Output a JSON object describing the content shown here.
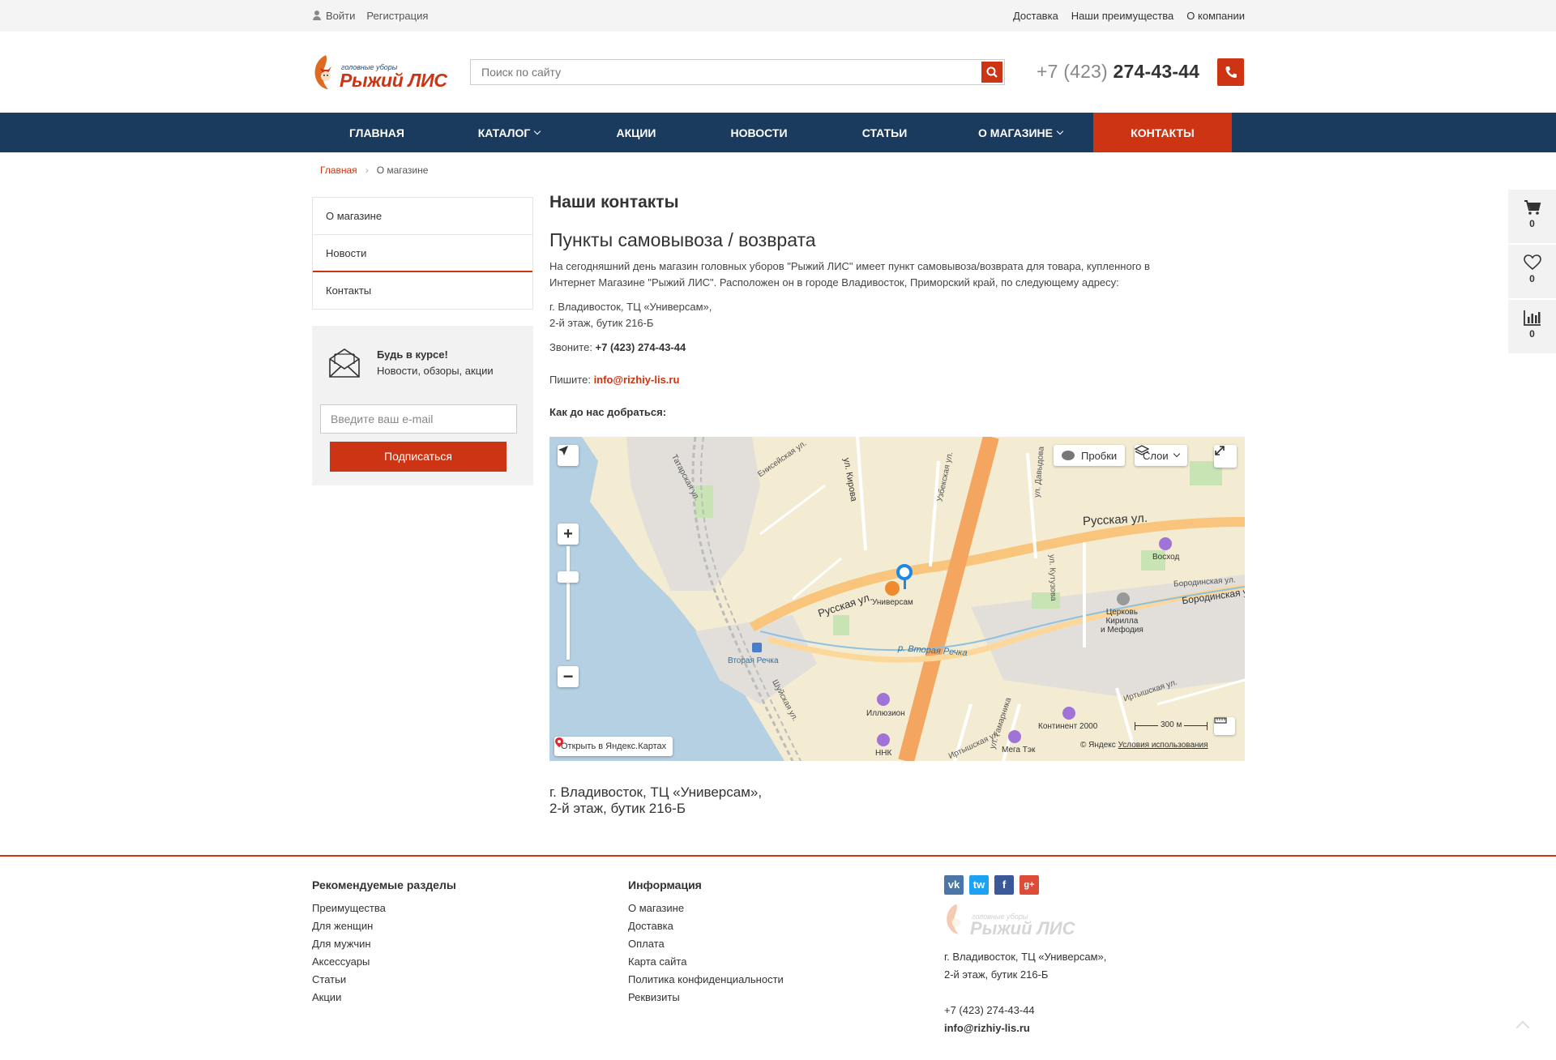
{
  "topbar": {
    "login": "Войти",
    "register": "Регистрация",
    "links": [
      "Доставка",
      "Наши преимущества",
      "О компании"
    ]
  },
  "header": {
    "logo_small": "головные уборы",
    "logo_big": "Рыжий ЛИС",
    "search_placeholder": "Поиск по сайту",
    "phone_code": "+7 (423) ",
    "phone_number": "274-43-44"
  },
  "nav": [
    {
      "label": "Главная",
      "has_menu": false
    },
    {
      "label": "Каталог",
      "has_menu": true
    },
    {
      "label": "Акции",
      "has_menu": false
    },
    {
      "label": "Новости",
      "has_menu": false
    },
    {
      "label": "Статьи",
      "has_menu": false
    },
    {
      "label": "О магазине",
      "has_menu": true
    },
    {
      "label": "Контакты",
      "has_menu": false,
      "active": true
    }
  ],
  "breadcrumb": {
    "home": "Главная",
    "current": "О магазине"
  },
  "sidemenu": [
    "О магазине",
    "Новости",
    "Контакты"
  ],
  "subscribe": {
    "title": "Будь в курсе!",
    "subtitle": "Новости, обзоры, акции",
    "placeholder": "Введите ваш e-mail",
    "button": "Подписаться"
  },
  "content": {
    "title": "Наши контакты",
    "subtitle": "Пункты самовывоза / возврата",
    "intro_1": "На сегодняшний день магазин головных уборов \"Рыжий ЛИС\" имеет пункт самовывоза/возврата для товара, купленного в",
    "intro_2": "Интернет Магазине \"Рыжий ЛИС\". Расположен он в городе Владивосток, Приморский край, по следующему адресу:",
    "address_1": "г. Владивосток, ТЦ «Универсам»,",
    "address_2": "2-й этаж, бутик 216-Б",
    "call_label": "Звоните: ",
    "call_value": "+7 (423) 274-43-44",
    "write_label": "Пишите: ",
    "write_value": "info@rizhiy-lis.ru",
    "howto": "Как до нас добраться:",
    "bottom_address_1": "г. Владивосток, ТЦ «Универсам»,",
    "bottom_address_2": "2-й этаж, бутик 216-Б"
  },
  "map": {
    "traffic": "Пробки",
    "layers": "Слои",
    "open_in": "Открыть в Яндекс.Картах",
    "scale": "300 м",
    "copyright": "© Яндекс",
    "terms": "Условия использования",
    "labels": {
      "russkaya_1": "Русская ул.",
      "russkaya_2": "Русская ул.",
      "kirova": "ул. Кирова",
      "eniseyskaya": "Енисейская ул.",
      "tatarskaya": "Татарская ул.",
      "uzbekskaya": "Узбекская ул.",
      "davydova": "ул. Давыдова",
      "kutuzova": "ул. Кутузова",
      "borodinskaya_1": "Бородинская ул.",
      "borodinskaya_2": "Бородинская ул.",
      "vtoraya_rechka_river": "р. Вторая Речка",
      "shuyskaya": "Шуйская ул.",
      "irtyshskaya_1": "Иртышская ул.",
      "irtyshskaya_2": "Иртышская ул.",
      "gamarnika": "ул. Гамарника",
      "universam": "Универсам",
      "voskhod": "Восход",
      "church_1": "Церковь",
      "church_2": "Кирилла",
      "church_3": "и Мефодия",
      "vtoraya_rechka": "Вторая Речка",
      "illuzion": "Иллюзион",
      "nnk": "ННК",
      "kontinent": "Континент 2000",
      "megatek": "Мега Тэк"
    }
  },
  "side_counters": {
    "cart": "0",
    "favorites": "0",
    "compare": "0"
  },
  "footer": {
    "col1_title": "Рекомендуемые разделы",
    "col1_links": [
      "Преимущества",
      "Для женщин",
      "Для мужчин",
      "Аксессуары",
      "Статьи",
      "Акции"
    ],
    "col2_title": "Информация",
    "col2_links": [
      "О магазине",
      "Доставка",
      "Оплата",
      "Карта сайта",
      "Политика конфиденциальности",
      "Реквизиты"
    ],
    "social": [
      "vk",
      "tw",
      "f",
      "g+"
    ],
    "address_1": "г. Владивосток, ТЦ «Универсам»,",
    "address_2": "2-й этаж, бутик 216-Б",
    "phone": "+7 (423) 274-43-44",
    "email": "info@rizhiy-lis.ru",
    "logo_small": "головные уборы",
    "logo_big": "Рыжий ЛИС"
  },
  "colors": {
    "accent": "#cd3413",
    "nav": "#1b3b5e"
  }
}
